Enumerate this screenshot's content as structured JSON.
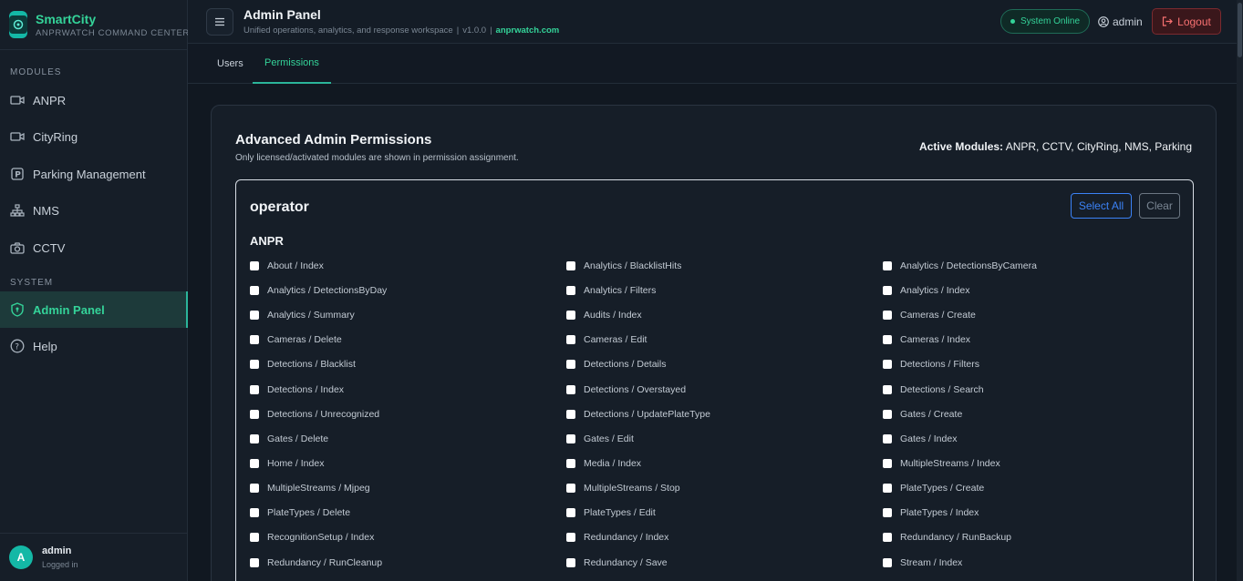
{
  "brand": {
    "title": "SmartCity",
    "subtitle": "ANPRWATCH COMMAND CENTER"
  },
  "sidebar": {
    "modules_label": "MODULES",
    "system_label": "SYSTEM",
    "modules": [
      {
        "label": "ANPR",
        "icon": "camera-icon"
      },
      {
        "label": "CityRing",
        "icon": "video-icon"
      },
      {
        "label": "Parking Management",
        "icon": "parking-icon"
      },
      {
        "label": "NMS",
        "icon": "network-icon"
      },
      {
        "label": "CCTV",
        "icon": "camera-photo-icon"
      }
    ],
    "system": [
      {
        "label": "Admin Panel",
        "icon": "shield-icon",
        "active": true
      },
      {
        "label": "Help",
        "icon": "help-icon"
      }
    ],
    "user": {
      "initial": "A",
      "name": "admin",
      "status": "Logged in"
    }
  },
  "header": {
    "title": "Admin Panel",
    "subtitle": "Unified operations, analytics, and response workspace",
    "version": "v1.0.0",
    "link": "anprwatch.com",
    "status": "System Online",
    "user": "admin",
    "logout": "Logout"
  },
  "tabs": [
    {
      "label": "Users",
      "active": false
    },
    {
      "label": "Permissions",
      "active": true
    }
  ],
  "card": {
    "title": "Advanced Admin Permissions",
    "subtitle": "Only licensed/activated modules are shown in permission assignment.",
    "active_modules_label": "Active Modules:",
    "active_modules": "ANPR, CCTV, CityRing, NMS, Parking"
  },
  "role": {
    "name": "operator",
    "select_all": "Select All",
    "clear": "Clear",
    "module": "ANPR",
    "permissions": [
      "About / Index",
      "Analytics / BlacklistHits",
      "Analytics / DetectionsByCamera",
      "Analytics / DetectionsByDay",
      "Analytics / Filters",
      "Analytics / Index",
      "Analytics / Summary",
      "Audits / Index",
      "Cameras / Create",
      "Cameras / Delete",
      "Cameras / Edit",
      "Cameras / Index",
      "Detections / Blacklist",
      "Detections / Details",
      "Detections / Filters",
      "Detections / Index",
      "Detections / Overstayed",
      "Detections / Search",
      "Detections / Unrecognized",
      "Detections / UpdatePlateType",
      "Gates / Create",
      "Gates / Delete",
      "Gates / Edit",
      "Gates / Index",
      "Home / Index",
      "Media / Index",
      "MultipleStreams / Index",
      "MultipleStreams / Mjpeg",
      "MultipleStreams / Stop",
      "PlateTypes / Create",
      "PlateTypes / Delete",
      "PlateTypes / Edit",
      "PlateTypes / Index",
      "RecognitionSetup / Index",
      "Redundancy / Index",
      "Redundancy / RunBackup",
      "Redundancy / RunCleanup",
      "Redundancy / Save",
      "Stream / Index"
    ]
  },
  "colors": {
    "accent": "#34d399",
    "primary": "#3b82f6",
    "danger": "#f87171",
    "background": "#111821"
  }
}
